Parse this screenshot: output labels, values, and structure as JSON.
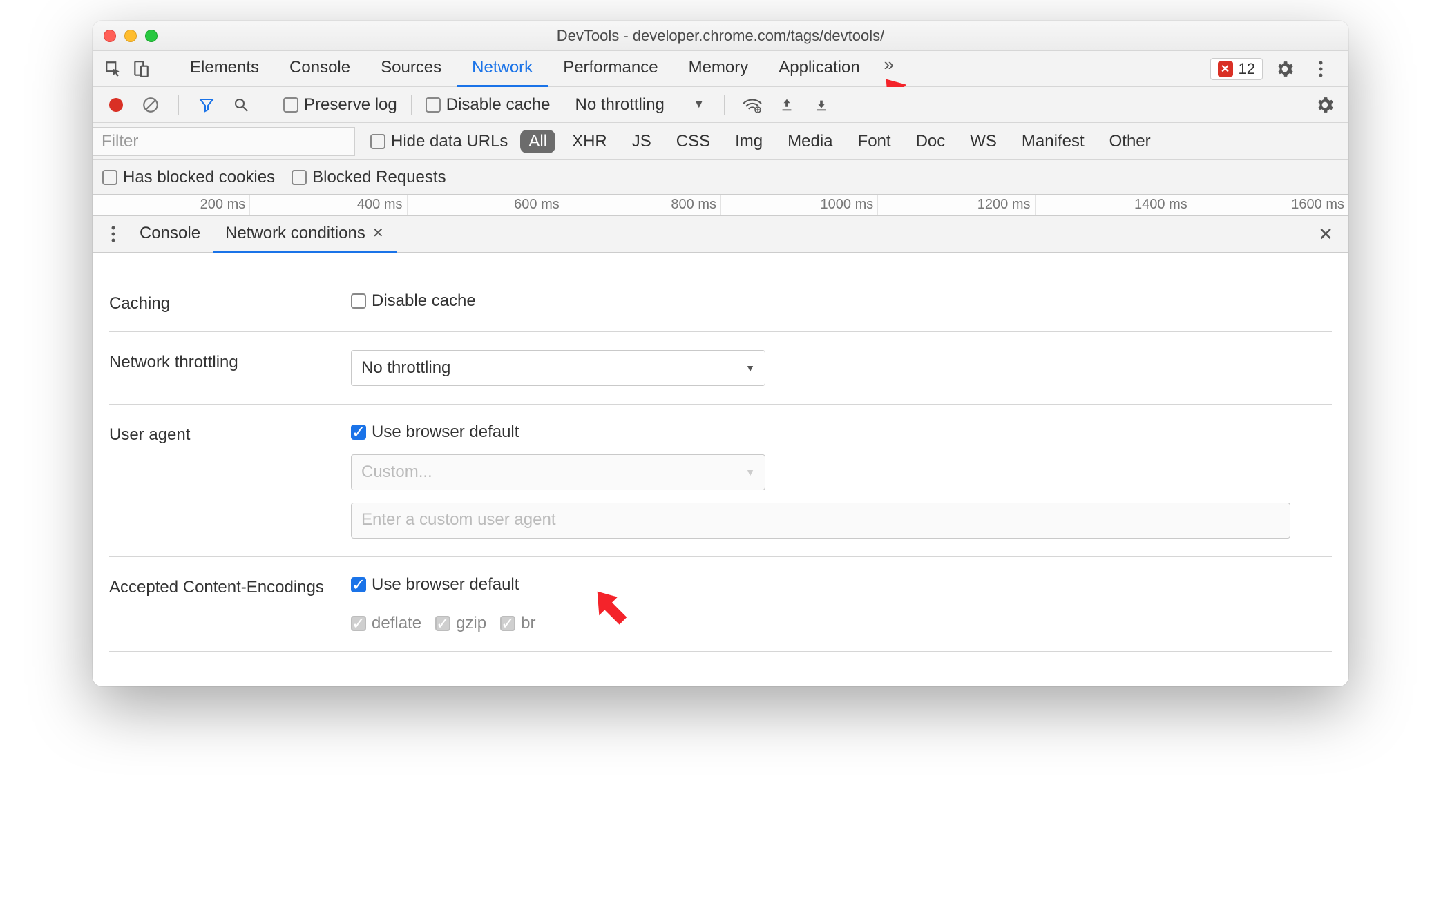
{
  "window": {
    "title": "DevTools - developer.chrome.com/tags/devtools/"
  },
  "main_tabs": {
    "items": [
      "Elements",
      "Console",
      "Sources",
      "Network",
      "Performance",
      "Memory",
      "Application"
    ],
    "active_index": 3,
    "errors": "12"
  },
  "net_toolbar": {
    "preserve_log": "Preserve log",
    "disable_cache": "Disable cache",
    "throttling_value": "No throttling"
  },
  "filter": {
    "placeholder": "Filter",
    "hide_data_urls": "Hide data URLs",
    "chips": [
      "All",
      "XHR",
      "JS",
      "CSS",
      "Img",
      "Media",
      "Font",
      "Doc",
      "WS",
      "Manifest",
      "Other"
    ],
    "active_chip_index": 0
  },
  "options": {
    "blocked_cookies": "Has blocked cookies",
    "blocked_requests": "Blocked Requests"
  },
  "timeline_ticks": [
    "200 ms",
    "400 ms",
    "600 ms",
    "800 ms",
    "1000 ms",
    "1200 ms",
    "1400 ms",
    "1600 ms"
  ],
  "drawer": {
    "tabs": [
      "Console",
      "Network conditions"
    ],
    "active_index": 1
  },
  "panel": {
    "caching": {
      "label": "Caching",
      "disable_cache": "Disable cache"
    },
    "throttling": {
      "label": "Network throttling",
      "value": "No throttling"
    },
    "ua": {
      "label": "User agent",
      "use_default": "Use browser default",
      "custom_placeholder": "Custom...",
      "textarea_placeholder": "Enter a custom user agent"
    },
    "accepted": {
      "label": "Accepted Content-Encodings",
      "use_default": "Use browser default",
      "encodings": [
        "deflate",
        "gzip",
        "br"
      ]
    }
  }
}
